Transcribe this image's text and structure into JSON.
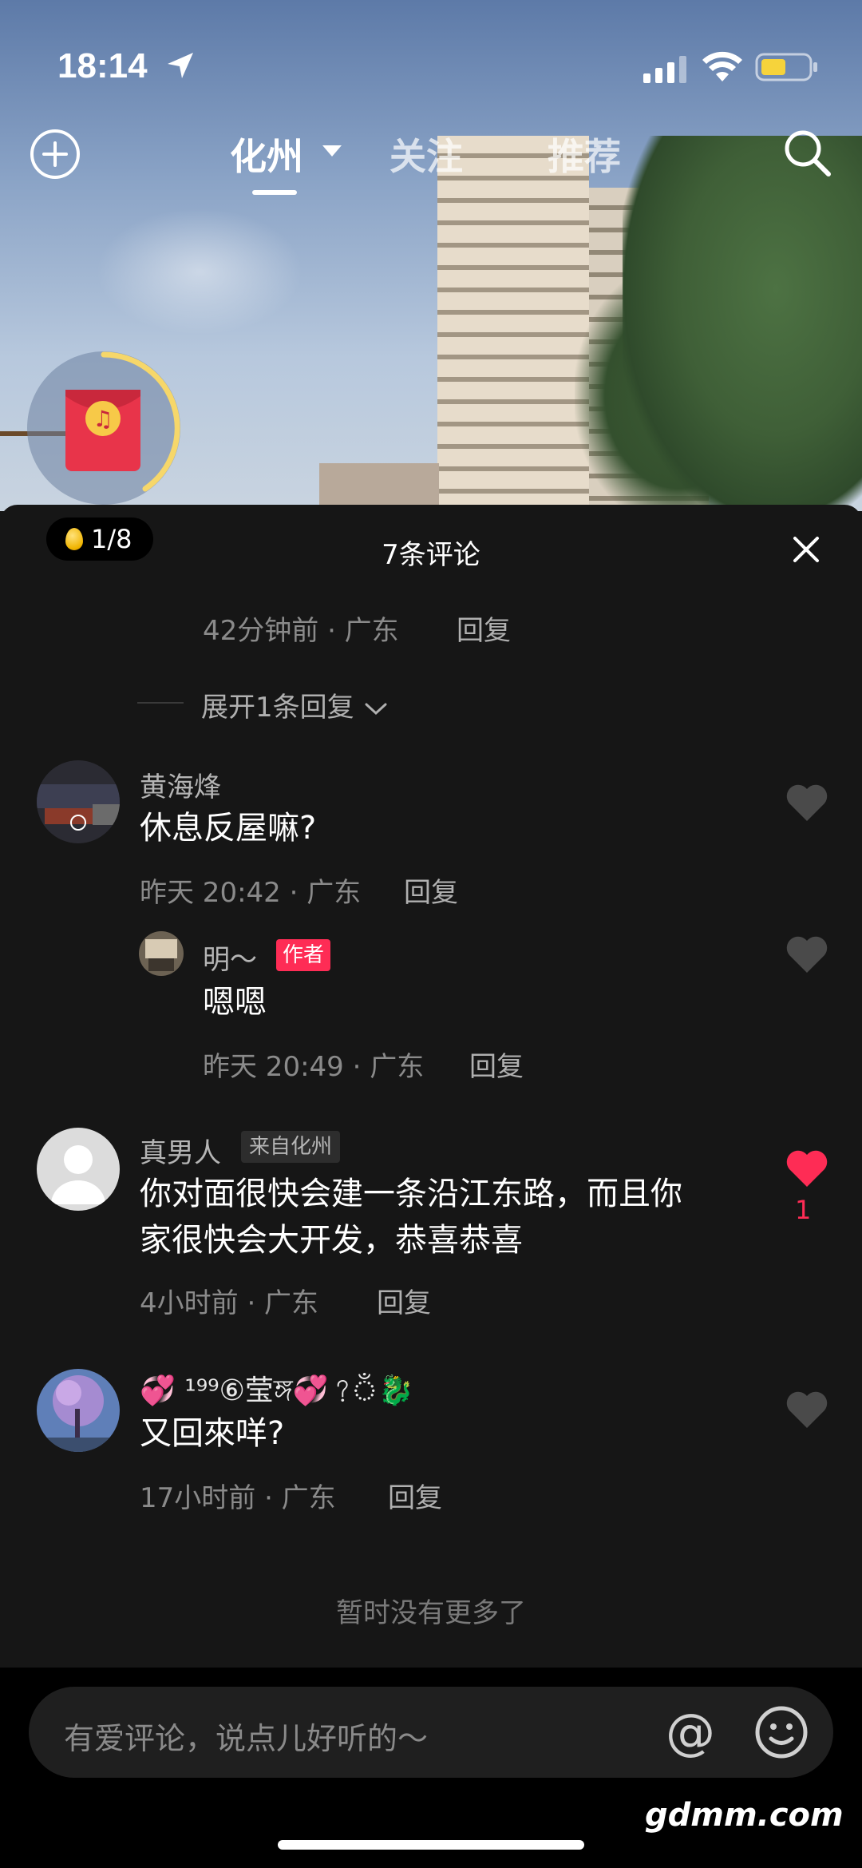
{
  "status_bar": {
    "time": "18:14"
  },
  "top_nav": {
    "tabs": [
      {
        "label": "化州",
        "active": true
      },
      {
        "label": "关注",
        "active": false
      },
      {
        "label": "推荐",
        "active": false
      }
    ]
  },
  "sheet": {
    "egg_counter": "1/8",
    "title": "7条评论"
  },
  "comments": [
    {
      "meta": "42分钟前 · 广东",
      "reply_label": "回复",
      "expand_label": "展开1条回复"
    },
    {
      "username": "黄海烽",
      "text": "休息反屋嘛?",
      "meta": "昨天 20:42 · 广东",
      "reply_label": "回复",
      "replies": [
        {
          "username": "明～",
          "tag": "作者",
          "text": "嗯嗯",
          "meta": "昨天 20:49 · 广东",
          "reply_label": "回复"
        }
      ]
    },
    {
      "username": "真男人",
      "tag": "来自化州",
      "text_line1": "你对面很快会建一条沿江东路，而且你",
      "text_line2": "家很快会大开发，恭喜恭喜",
      "meta": "4小时前 · 广东",
      "reply_label": "回复",
      "likes": "1",
      "liked": true
    },
    {
      "username": "💞 ¹⁹⁹⑥莹ঙ্গ💞?ঁ🐉",
      "text": "又回來咩?",
      "meta": "17小时前 · 广东",
      "reply_label": "回复"
    }
  ],
  "footer_note": "暂时没有更多了",
  "input": {
    "placeholder": "有爱评论，说点儿好听的～",
    "at_symbol": "@"
  },
  "watermark": "gdmm.com",
  "colors": {
    "accent": "#fe2c55",
    "sheet_bg": "#161616",
    "secondary_text": "#8a8a8a"
  }
}
